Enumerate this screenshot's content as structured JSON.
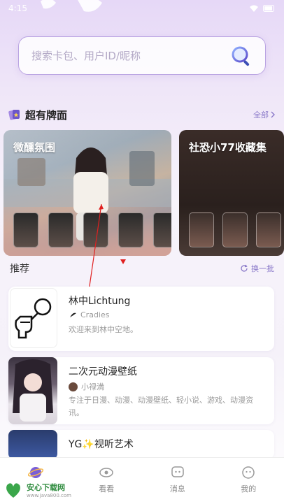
{
  "status": {
    "time": "4:15"
  },
  "search": {
    "placeholder": "搜索卡包、用户ID/昵称"
  },
  "featured": {
    "title": "超有牌面",
    "see_all": "全部",
    "cards": [
      {
        "title": "微醺氛围"
      },
      {
        "title": "社恐小77收藏集"
      }
    ]
  },
  "recommend": {
    "title": "推荐",
    "refresh": "换一批",
    "items": [
      {
        "name": "林中Lichtung",
        "user": "Cradies",
        "desc": "欢迎来到林中空地。"
      },
      {
        "name": "二次元动漫壁纸",
        "user": "小禄満",
        "desc": "专注于日漫、动漫、动漫壁纸、轻小说、游戏、动漫资讯。"
      },
      {
        "name": "YG✨视听艺术"
      }
    ]
  },
  "tabbar": {
    "tabs": [
      {
        "label": ""
      },
      {
        "label": "看看"
      },
      {
        "label": "消息"
      },
      {
        "label": "我的"
      }
    ]
  },
  "watermark": {
    "title": "安心下载网",
    "sub": "www.java800.com"
  },
  "colors": {
    "accent": "#8a79c9",
    "tab_active": "#6b55c9",
    "marker": "#e02020"
  }
}
